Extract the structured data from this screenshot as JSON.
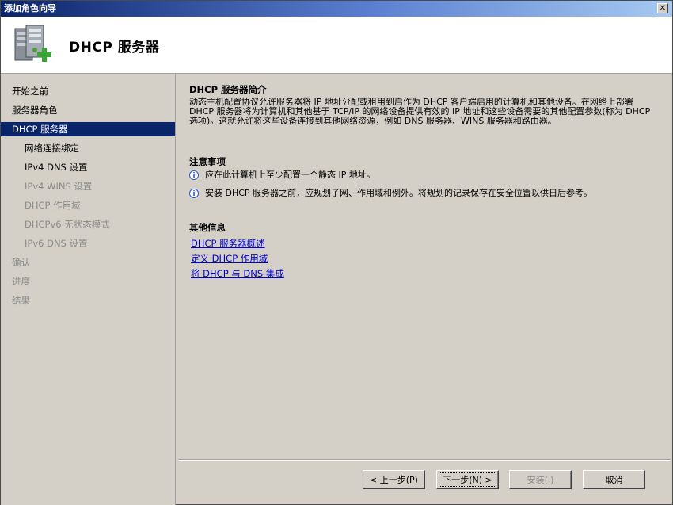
{
  "window": {
    "title": "添加角色向导",
    "close_glyph": "✕"
  },
  "header": {
    "title": "DHCP 服务器",
    "icon": "dhcp-server-icon"
  },
  "nav": {
    "items": [
      {
        "label": "开始之前",
        "level": 0,
        "state": "normal"
      },
      {
        "label": "服务器角色",
        "level": 0,
        "state": "normal"
      },
      {
        "label": "DHCP 服务器",
        "level": 0,
        "state": "selected"
      },
      {
        "label": "网络连接绑定",
        "level": 1,
        "state": "normal"
      },
      {
        "label": "IPv4 DNS 设置",
        "level": 1,
        "state": "normal"
      },
      {
        "label": "IPv4 WINS 设置",
        "level": 1,
        "state": "disabled"
      },
      {
        "label": "DHCP 作用域",
        "level": 1,
        "state": "disabled"
      },
      {
        "label": "DHCPv6 无状态模式",
        "level": 1,
        "state": "disabled"
      },
      {
        "label": "IPv6 DNS 设置",
        "level": 1,
        "state": "disabled"
      },
      {
        "label": "确认",
        "level": 0,
        "state": "disabled"
      },
      {
        "label": "进度",
        "level": 0,
        "state": "disabled"
      },
      {
        "label": "结果",
        "level": 0,
        "state": "disabled"
      }
    ]
  },
  "content": {
    "intro_title": "DHCP 服务器简介",
    "intro_text": "动态主机配置协议允许服务器将 IP 地址分配或租用到启作为 DHCP 客户端启用的计算机和其他设备。在网络上部署 DHCP 服务器将为计算机和其他基于 TCP/IP 的网络设备提供有效的 IP 地址和这些设备需要的其他配置参数(称为 DHCP 选项)。这就允许将这些设备连接到其他网络资源，例如 DNS 服务器、WINS 服务器和路由器。",
    "notes_title": "注意事项",
    "notes": [
      "应在此计算机上至少配置一个静态 IP 地址。",
      "安装 DHCP 服务器之前，应规划子网、作用域和例外。将规划的记录保存在安全位置以供日后参考。"
    ],
    "more_title": "其他信息",
    "links": [
      "DHCP 服务器概述",
      "定义 DHCP 作用域",
      "将 DHCP 与 DNS 集成"
    ]
  },
  "buttons": {
    "previous": "< 上一步(P)",
    "next": "下一步(N) >",
    "install": "安装(I)",
    "cancel": "取消"
  },
  "colors": {
    "selection": "#0a246a",
    "link": "#0000cc",
    "window_bg": "#d4d0c8"
  }
}
